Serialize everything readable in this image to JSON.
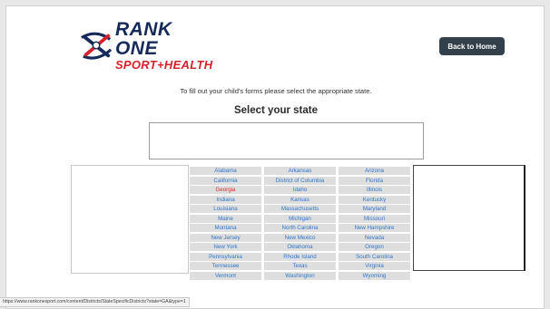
{
  "brand": {
    "line1": "RANK ONE",
    "line2": "SPORT+HEALTH"
  },
  "header": {
    "back_label": "Back to Home"
  },
  "main": {
    "instructions": "To fill out your child's forms please select the appropriate state.",
    "heading": "Select your state"
  },
  "states": [
    {
      "label": "Alabama"
    },
    {
      "label": "Arkansas"
    },
    {
      "label": "Arizona"
    },
    {
      "label": "California"
    },
    {
      "label": "District of Columbia"
    },
    {
      "label": "Florida"
    },
    {
      "label": "Georgia",
      "active": true
    },
    {
      "label": "Idaho"
    },
    {
      "label": "Illinois"
    },
    {
      "label": "Indiana"
    },
    {
      "label": "Kansas"
    },
    {
      "label": "Kentucky"
    },
    {
      "label": "Louisiana"
    },
    {
      "label": "Massachusetts"
    },
    {
      "label": "Maryland"
    },
    {
      "label": "Maine"
    },
    {
      "label": "Michigan"
    },
    {
      "label": "Missouri"
    },
    {
      "label": "Montana"
    },
    {
      "label": "North Carolina"
    },
    {
      "label": "New Hampshire"
    },
    {
      "label": "New Jersey"
    },
    {
      "label": "New Mexico"
    },
    {
      "label": "Nevada"
    },
    {
      "label": "New York"
    },
    {
      "label": "Oklahoma"
    },
    {
      "label": "Oregon"
    },
    {
      "label": "Pennsylvania"
    },
    {
      "label": "Rhode Island"
    },
    {
      "label": "South Carolina"
    },
    {
      "label": "Tennessee"
    },
    {
      "label": "Texas"
    },
    {
      "label": "Virginia"
    },
    {
      "label": "Vermont"
    },
    {
      "label": "Washington"
    },
    {
      "label": "Wyoming"
    }
  ],
  "status_bar": {
    "url": "https://www.rankonesport.com/content/Districts/StateSpecificDistricts?state=GA&type=1"
  },
  "colors": {
    "brand_navy": "#162a59",
    "brand_red": "#d6202c",
    "link_blue": "#2f76c9",
    "active_red": "#d92b2b",
    "button_bg": "#32404c",
    "cell_bg": "#dedede"
  },
  "icons": {
    "logo": "rank-one-logo-icon"
  }
}
